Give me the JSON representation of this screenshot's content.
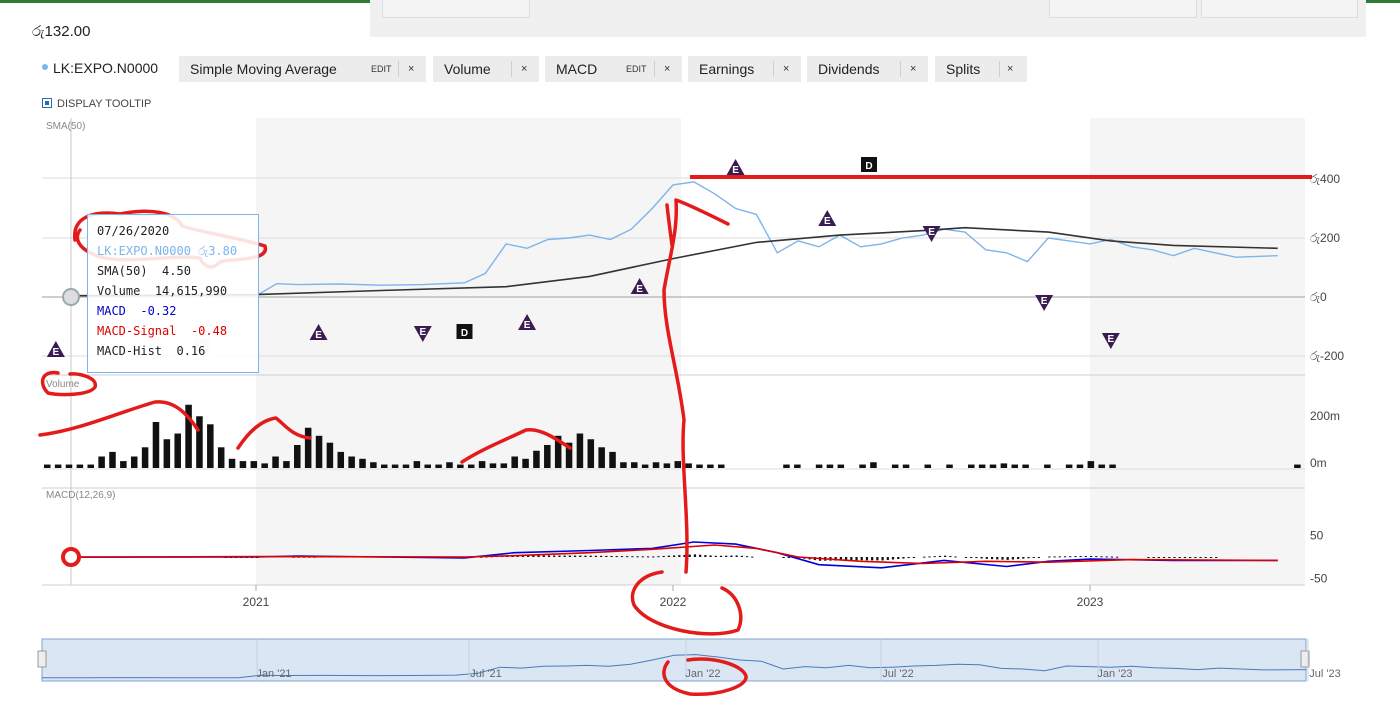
{
  "header": {
    "price": "රු132.00"
  },
  "toolbar": {
    "ticker": "LK:EXPO.N0000",
    "chips": [
      {
        "label": "Simple Moving Average",
        "edit": "EDIT",
        "close": "×"
      },
      {
        "label": "Volume",
        "close": "×"
      },
      {
        "label": "MACD",
        "edit": "EDIT",
        "close": "×"
      },
      {
        "label": "Earnings",
        "close": "×"
      },
      {
        "label": "Dividends",
        "close": "×"
      },
      {
        "label": "Splits",
        "close": "×"
      }
    ],
    "display_tooltip": "DISPLAY TOOLTIP"
  },
  "tooltip": {
    "date": "07/26/2020",
    "ticker": "LK:EXPO.N0000",
    "price": "රු3.80",
    "sma_label": "SMA(50)",
    "sma_value": "4.50",
    "volume_label": "Volume",
    "volume_value": "14,615,990",
    "macd_label": "MACD",
    "macd_value": "-0.32",
    "signal_label": "MACD-Signal",
    "signal_value": "-0.48",
    "hist_label": "MACD-Hist",
    "hist_value": "0.16"
  },
  "chart_data": {
    "type": "line",
    "panels": {
      "price": {
        "label": "SMA(50)",
        "y_ticks": [
          "රු400",
          "රු200",
          "රු0",
          "රු-200"
        ],
        "y_values": [
          400,
          200,
          0,
          -200
        ],
        "ylim": [
          -250,
          550
        ],
        "series": [
          {
            "name": "LK:EXPO.N0000",
            "color": "#7cb5ec",
            "points": [
              [
                2020.55,
                3.8
              ],
              [
                2020.65,
                5
              ],
              [
                2020.75,
                6
              ],
              [
                2020.85,
                4
              ],
              [
                2020.95,
                5
              ],
              [
                2021.0,
                4
              ],
              [
                2021.05,
                45
              ],
              [
                2021.1,
                42
              ],
              [
                2021.2,
                44
              ],
              [
                2021.3,
                40
              ],
              [
                2021.4,
                42
              ],
              [
                2021.5,
                48
              ],
              [
                2021.55,
                80
              ],
              [
                2021.6,
                180
              ],
              [
                2021.65,
                165
              ],
              [
                2021.7,
                195
              ],
              [
                2021.75,
                200
              ],
              [
                2021.8,
                210
              ],
              [
                2021.85,
                195
              ],
              [
                2021.9,
                230
              ],
              [
                2021.95,
                300
              ],
              [
                2022.0,
                380
              ],
              [
                2022.05,
                390
              ],
              [
                2022.1,
                350
              ],
              [
                2022.15,
                300
              ],
              [
                2022.2,
                280
              ],
              [
                2022.25,
                150
              ],
              [
                2022.3,
                190
              ],
              [
                2022.35,
                170
              ],
              [
                2022.4,
                210
              ],
              [
                2022.45,
                170
              ],
              [
                2022.5,
                180
              ],
              [
                2022.55,
                200
              ],
              [
                2022.6,
                210
              ],
              [
                2022.65,
                230
              ],
              [
                2022.7,
                220
              ],
              [
                2022.75,
                160
              ],
              [
                2022.8,
                150
              ],
              [
                2022.85,
                120
              ],
              [
                2022.9,
                200
              ],
              [
                2022.95,
                190
              ],
              [
                2023.0,
                180
              ],
              [
                2023.05,
                195
              ],
              [
                2023.1,
                170
              ],
              [
                2023.15,
                160
              ],
              [
                2023.2,
                140
              ],
              [
                2023.25,
                165
              ],
              [
                2023.3,
                150
              ],
              [
                2023.35,
                135
              ],
              [
                2023.45,
                140
              ]
            ]
          },
          {
            "name": "SMA(50)",
            "color": "#333333",
            "points": [
              [
                2020.55,
                4.5
              ],
              [
                2020.8,
                5
              ],
              [
                2021.0,
                8
              ],
              [
                2021.3,
                22
              ],
              [
                2021.6,
                35
              ],
              [
                2021.8,
                70
              ],
              [
                2022.0,
                130
              ],
              [
                2022.2,
                185
              ],
              [
                2022.4,
                210
              ],
              [
                2022.6,
                225
              ],
              [
                2022.7,
                235
              ],
              [
                2022.9,
                220
              ],
              [
                2023.05,
                190
              ],
              [
                2023.2,
                175
              ],
              [
                2023.45,
                165
              ]
            ]
          }
        ],
        "earnings": [
          {
            "x": 2020.52,
            "dir": "up"
          },
          {
            "x": 2021.15,
            "dir": "up"
          },
          {
            "x": 2021.4,
            "dir": "down"
          },
          {
            "x": 2021.65,
            "dir": "up"
          },
          {
            "x": 2021.92,
            "dir": "up"
          },
          {
            "x": 2022.15,
            "dir": "up"
          },
          {
            "x": 2022.37,
            "dir": "up"
          },
          {
            "x": 2022.62,
            "dir": "down"
          },
          {
            "x": 2022.89,
            "dir": "down"
          },
          {
            "x": 2023.05,
            "dir": "down"
          }
        ],
        "dividends": [
          {
            "x": 2020.87
          },
          {
            "x": 2021.5
          },
          {
            "x": 2022.47
          }
        ],
        "earnings_label": "E",
        "dividend_label": "D"
      },
      "volume": {
        "label": "Volume",
        "y_ticks": [
          "200m",
          "0m"
        ],
        "values": [
          3,
          3,
          3,
          3,
          3,
          10,
          14,
          6,
          10,
          18,
          40,
          25,
          30,
          55,
          45,
          38,
          18,
          8,
          6,
          6,
          4,
          10,
          6,
          20,
          35,
          28,
          22,
          14,
          10,
          8,
          5,
          3,
          3,
          3,
          6,
          3,
          3,
          5,
          3,
          3,
          6,
          4,
          4,
          10,
          8,
          15,
          20,
          28,
          22,
          30,
          25,
          18,
          14,
          5,
          5,
          3,
          5,
          4,
          6,
          4,
          3,
          3,
          3,
          0,
          0,
          0,
          0,
          0,
          3,
          3,
          0,
          3,
          3,
          3,
          0,
          3,
          5,
          0,
          3,
          3,
          0,
          3,
          0,
          3,
          0,
          3,
          3,
          3,
          4,
          3,
          3,
          0,
          3,
          0,
          3,
          3,
          6,
          3,
          3,
          0,
          0,
          0,
          0,
          0,
          0,
          0,
          0,
          0,
          0,
          0,
          0,
          0,
          0,
          0,
          0,
          3
        ]
      },
      "macd": {
        "label": "MACD(12,26,9)",
        "y_ticks": [
          "50",
          "-50"
        ],
        "y_values": [
          50,
          -50
        ],
        "series": [
          {
            "name": "MACD",
            "color": "#0000dd",
            "points": [
              [
                2020.55,
                -0.32
              ],
              [
                2021.0,
                0
              ],
              [
                2021.1,
                2
              ],
              [
                2021.5,
                -2
              ],
              [
                2021.62,
                10
              ],
              [
                2021.8,
                15
              ],
              [
                2021.95,
                20
              ],
              [
                2022.05,
                35
              ],
              [
                2022.15,
                30
              ],
              [
                2022.25,
                10
              ],
              [
                2022.35,
                -18
              ],
              [
                2022.5,
                -25
              ],
              [
                2022.65,
                -8
              ],
              [
                2022.8,
                -22
              ],
              [
                2022.9,
                -10
              ],
              [
                2023.0,
                -5
              ],
              [
                2023.2,
                -8
              ],
              [
                2023.45,
                -8
              ]
            ]
          },
          {
            "name": "MACD-Signal",
            "color": "#dd0000",
            "points": [
              [
                2020.55,
                -0.48
              ],
              [
                2021.0,
                1
              ],
              [
                2021.5,
                0
              ],
              [
                2021.62,
                3
              ],
              [
                2021.8,
                10
              ],
              [
                2021.95,
                18
              ],
              [
                2022.1,
                28
              ],
              [
                2022.2,
                20
              ],
              [
                2022.3,
                0
              ],
              [
                2022.45,
                -10
              ],
              [
                2022.6,
                -15
              ],
              [
                2022.75,
                -10
              ],
              [
                2022.9,
                -12
              ],
              [
                2023.1,
                -6
              ],
              [
                2023.45,
                -8
              ]
            ]
          }
        ]
      }
    },
    "x_ticks": [
      "2021",
      "2022",
      "2023"
    ],
    "navigator_ticks": [
      "Jan '21",
      "Jul '21",
      "Jan '22",
      "Jul '22",
      "Jan '23",
      "Jul '23"
    ]
  },
  "colors": {
    "price_line": "#7cb5ec",
    "sma_line": "#333333",
    "macd_line": "#0000dd",
    "signal_line": "#dd0000",
    "earnings_marker": "#3b1c52",
    "annotation_red": "#e31b1b",
    "accent_green": "#2e7d32"
  }
}
